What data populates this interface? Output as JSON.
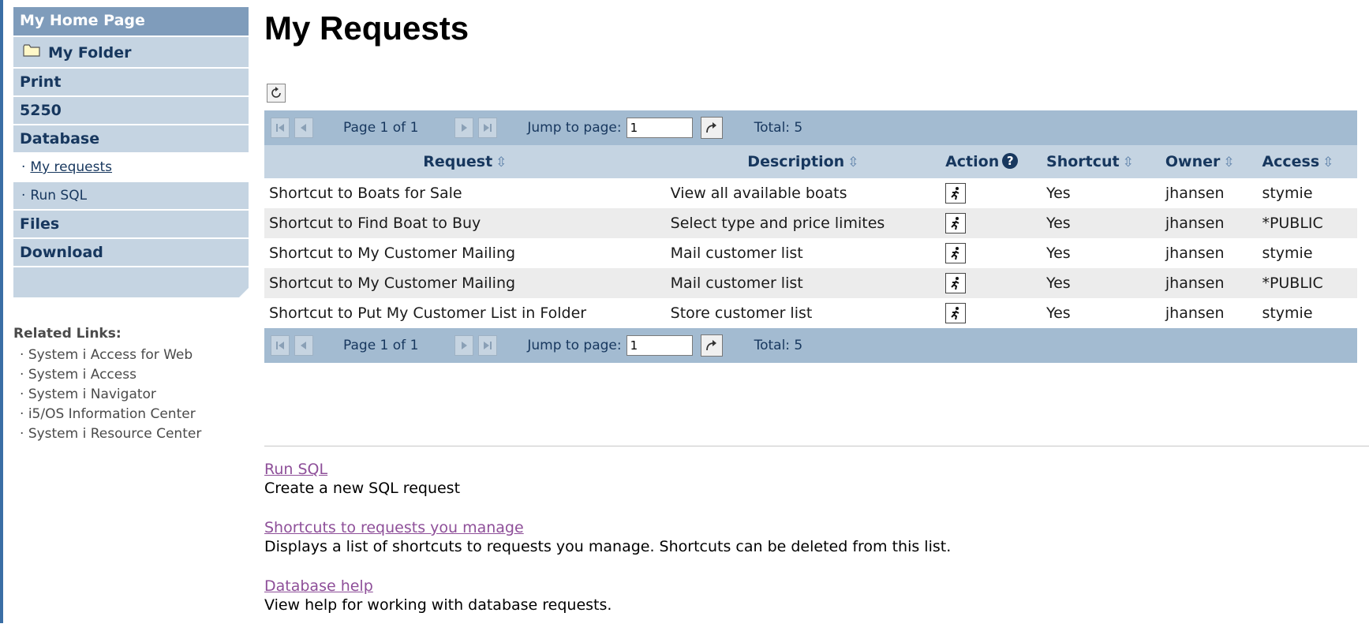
{
  "sidebar": {
    "home": "My Home Page",
    "folder": "My Folder",
    "print": "Print",
    "s5250": "5250",
    "database": "Database",
    "sub_items": [
      {
        "label": "My requests"
      },
      {
        "label": "Run SQL"
      }
    ],
    "files": "Files",
    "download": "Download",
    "related_title": "Related Links:",
    "related_links": [
      "System i Access for Web",
      "System i Access",
      "System i Navigator",
      "i5/OS Information Center",
      "System i Resource Center"
    ]
  },
  "main": {
    "title": "My Requests",
    "pager": {
      "page_text": "Page 1 of 1",
      "jump_label": "Jump to page:",
      "jump_value": "1",
      "total": "Total: 5"
    },
    "columns": {
      "request": "Request",
      "description": "Description",
      "action": "Action",
      "shortcut": "Shortcut",
      "owner": "Owner",
      "access": "Access"
    },
    "rows": [
      {
        "request": "Shortcut to Boats for Sale",
        "description": "View all available boats",
        "shortcut": "Yes",
        "owner": "jhansen",
        "access": "stymie"
      },
      {
        "request": "Shortcut to Find Boat to Buy",
        "description": "Select type and price limites",
        "shortcut": "Yes",
        "owner": "jhansen",
        "access": "*PUBLIC"
      },
      {
        "request": "Shortcut to My Customer Mailing",
        "description": "Mail customer list",
        "shortcut": "Yes",
        "owner": "jhansen",
        "access": "stymie"
      },
      {
        "request": "Shortcut to My Customer Mailing",
        "description": "Mail customer list",
        "shortcut": "Yes",
        "owner": "jhansen",
        "access": "*PUBLIC"
      },
      {
        "request": "Shortcut to Put My Customer List in Folder",
        "description": "Store customer list",
        "shortcut": "Yes",
        "owner": "jhansen",
        "access": "stymie"
      }
    ],
    "links": [
      {
        "label": "Run SQL",
        "desc": "Create a new SQL request"
      },
      {
        "label": "Shortcuts to requests you manage",
        "desc": "Displays a list of shortcuts to requests you manage. Shortcuts can be deleted from this list."
      },
      {
        "label": "Database help",
        "desc": "View help for working with database requests."
      }
    ]
  },
  "colors": {
    "nav_bg": "#c5d4e2",
    "nav_home_bg": "#7f9cbb",
    "pager_bg": "#a3bbd1",
    "link_visited": "#8e4f99"
  }
}
